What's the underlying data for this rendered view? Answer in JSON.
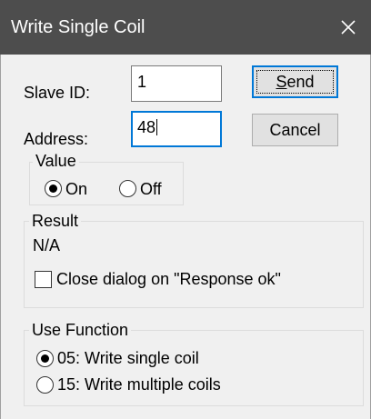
{
  "window": {
    "title": "Write Single Coil",
    "close_glyph": "✕"
  },
  "form": {
    "slave_id_label": "Slave ID:",
    "slave_id_value": "1",
    "address_label": "Address:",
    "address_value": "48"
  },
  "buttons": {
    "send_label_accel": "S",
    "send_label_rest": "end",
    "cancel_label": "Cancel"
  },
  "value_group": {
    "title": "Value",
    "options": [
      {
        "label": "On",
        "checked": true
      },
      {
        "label": "Off",
        "checked": false
      }
    ]
  },
  "result_group": {
    "title": "Result",
    "status": "N/A",
    "close_on_ok_label": "Close dialog on \"Response ok\"",
    "close_on_ok_checked": false
  },
  "function_group": {
    "title": "Use Function",
    "options": [
      {
        "label": "05: Write single coil",
        "checked": true
      },
      {
        "label": "15: Write multiple coils",
        "checked": false
      }
    ]
  },
  "colors": {
    "titlebar": "#4d4d4d",
    "dialog_background": "#f0f0f0",
    "focus_accent": "#0078d7"
  }
}
